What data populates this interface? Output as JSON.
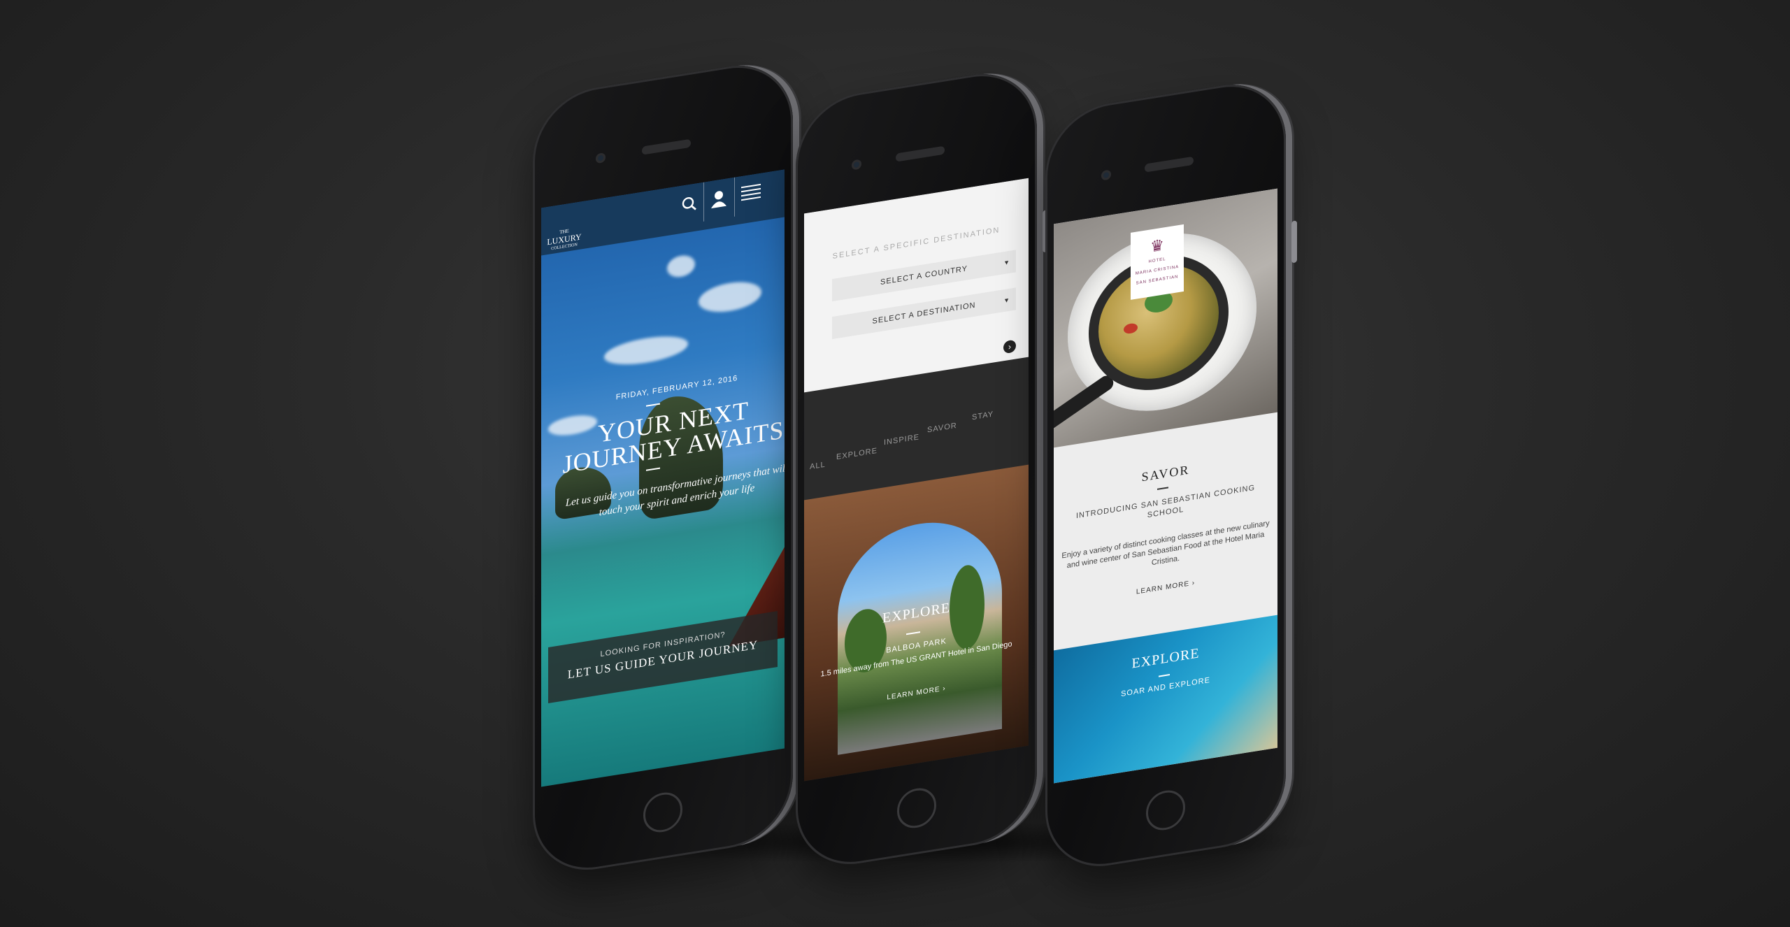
{
  "phone_home": {
    "logo": {
      "line1": "THE",
      "line2": "LUXURY",
      "line3": "COLLECTION"
    },
    "date": "FRIDAY, FEBRUARY 12, 2016",
    "hero_line1": "YOUR NEXT",
    "hero_line2": "JOURNEY AWAITS",
    "subtitle": "Let us guide you on transformative journeys that will touch your spirit and enrich your life",
    "cta_small": "LOOKING FOR INSPIRATION?",
    "cta_large": "LET US GUIDE YOUR JOURNEY",
    "icons": {
      "search": "search-icon",
      "user": "user-icon",
      "menu": "menu-icon"
    }
  },
  "phone_explore": {
    "destination_heading": "SELECT A SPECIFIC DESTINATION",
    "country_select": "SELECT A COUNTRY",
    "destination_select": "SELECT A DESTINATION",
    "tabs": [
      "ALL",
      "EXPLORE",
      "INSPIRE",
      "SAVOR",
      "STAY"
    ],
    "card": {
      "title": "EXPLORE",
      "place": "BALBOA PARK",
      "description": "1.5 miles away from The US GRANT Hotel in San Diego",
      "learn_more": "LEARN MORE ›"
    }
  },
  "phone_savor": {
    "badge": {
      "line1": "HOTEL",
      "line2": "MARIA CRISTINA",
      "line3": "SAN SEBASTIAN"
    },
    "title": "SAVOR",
    "subtitle": "INTRODUCING SAN SEBASTIAN COOKING SCHOOL",
    "description": "Enjoy a variety of distinct cooking classes at the new culinary and wine center of San Sebastian Food at the Hotel Maria Cristina.",
    "learn_more": "LEARN MORE ›",
    "bottom_title": "EXPLORE",
    "bottom_subtitle": "SOAR AND EXPLORE"
  }
}
